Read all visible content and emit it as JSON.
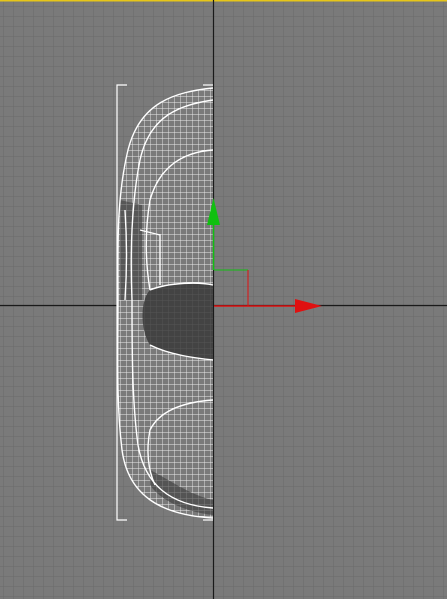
{
  "viewport": {
    "background": "#7a7a7a",
    "grid_color": "#6a6a6a",
    "axis_color": "#1a1a1a",
    "active_border_color": "#e6c619"
  },
  "model": {
    "wire_color": "#ffffff",
    "shade_color": "#3a3a3a"
  },
  "gizmo": {
    "x_axis_color": "#e01010",
    "y_axis_color": "#10c010"
  }
}
